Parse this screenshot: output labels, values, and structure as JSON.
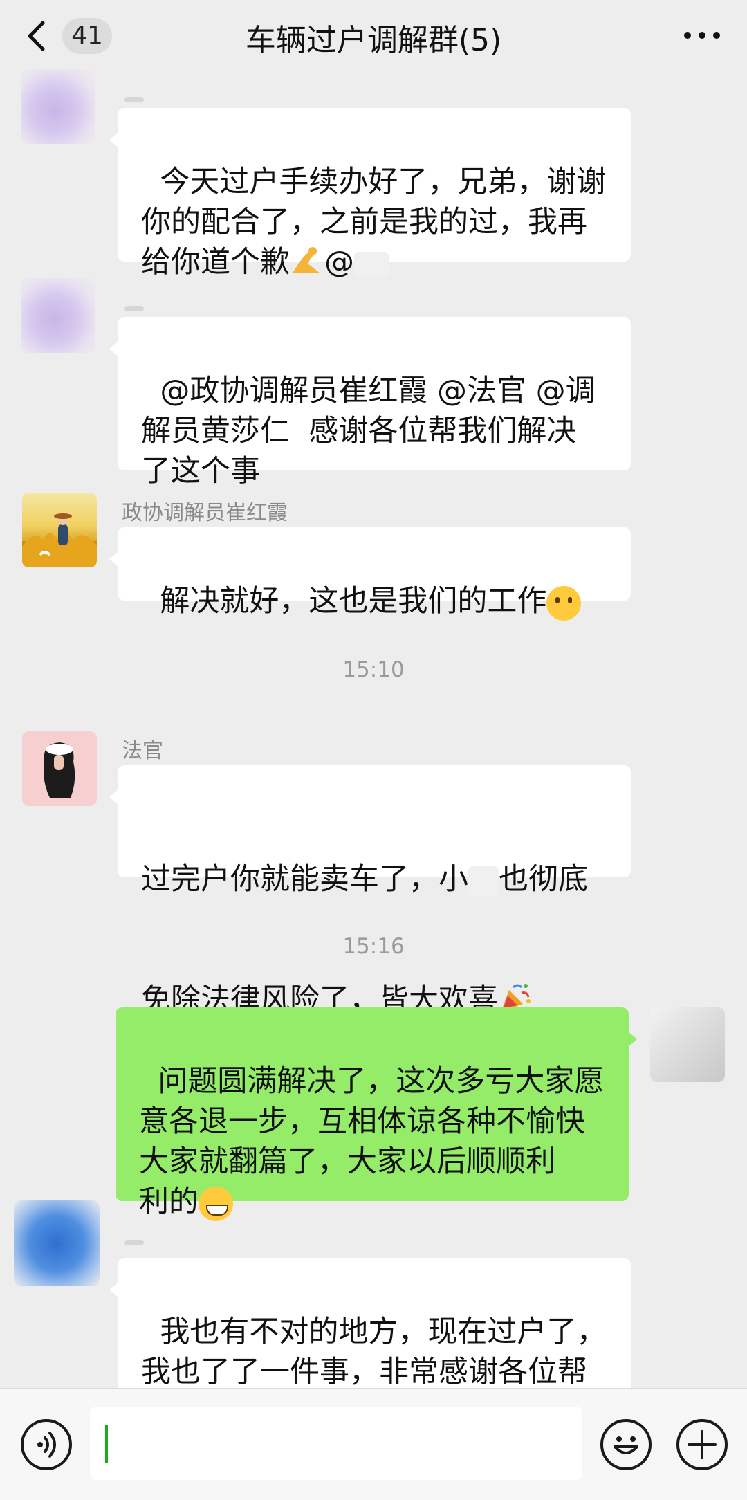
{
  "header": {
    "unread_count": "41",
    "title": "车辆过户调解群(5)"
  },
  "messages": [
    {
      "text": "今天过户手续办好了，兄弟，谢谢\n你的配合了，之前是我的过，我再\n给你道个歉",
      "mention": "@"
    },
    {
      "text": "@政协调解员崔红霞 @法官 @调\n解员黄莎仁  感谢各位帮我们解决\n了这个事"
    },
    {
      "sender": "政协调解员崔红霞",
      "text": "解决就好，这也是我们的工作"
    },
    {
      "sender": "法官",
      "line1_a": "过完户你就能卖车了，小",
      "line1_b": "也彻底",
      "line2": "免除法律风险了，皆大欢喜"
    },
    {
      "text": "问题圆满解决了，这次多亏大家愿\n意各退一步，互相体谅各种不愉快\n大家就翻篇了，大家以后顺顺利\n利的"
    },
    {
      "text": "我也有不对的地方，现在过户了，\n我也了了一件事，非常感谢各位帮\n我俩调解。"
    }
  ],
  "timestamps": [
    "15:10",
    "15:16"
  ],
  "icons": {
    "back": "chevron-left-icon",
    "more": "more-dots-icon",
    "voice": "voice-icon",
    "emoji": "emoji-icon",
    "plus": "plus-icon",
    "bow": "bow-emoji-icon",
    "smile": "smile-emoji-icon",
    "party": "party-popper-emoji-icon",
    "grin": "grin-emoji-icon"
  },
  "colors": {
    "background": "#ededed",
    "bubble_other": "#ffffff",
    "bubble_self": "#95ec69",
    "cursor": "#1aad19"
  }
}
